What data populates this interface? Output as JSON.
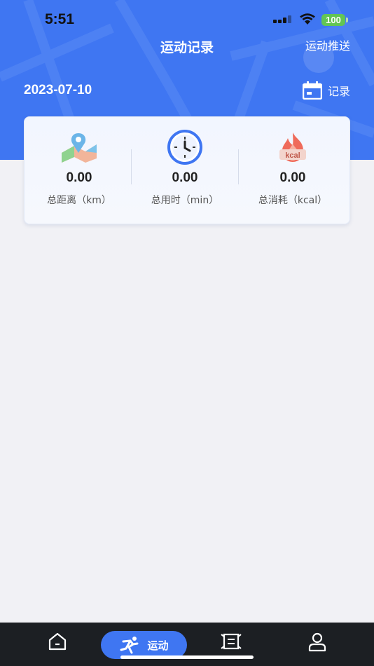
{
  "status_bar": {
    "time": "5:51",
    "battery": "100"
  },
  "header": {
    "title": "运动记录",
    "push_label": "运动推送"
  },
  "date_row": {
    "date": "2023-07-10",
    "record_label": "记录"
  },
  "summary": {
    "stats": [
      {
        "value": "0.00",
        "label": "总距离（km）",
        "icon": "map-icon"
      },
      {
        "value": "0.00",
        "label": "总用时（min）",
        "icon": "clock-icon"
      },
      {
        "value": "0.00",
        "label": "总消耗（kcal）",
        "icon": "flame-kcal-icon",
        "icon_text": "kcal"
      }
    ]
  },
  "tabbar": {
    "active_label": "运动",
    "items": [
      "home-icon",
      "running-icon",
      "scroll-icon",
      "profile-icon"
    ]
  },
  "colors": {
    "primary": "#3f76f2",
    "background": "#f1f1f5",
    "tabbar": "#1c1f23"
  }
}
